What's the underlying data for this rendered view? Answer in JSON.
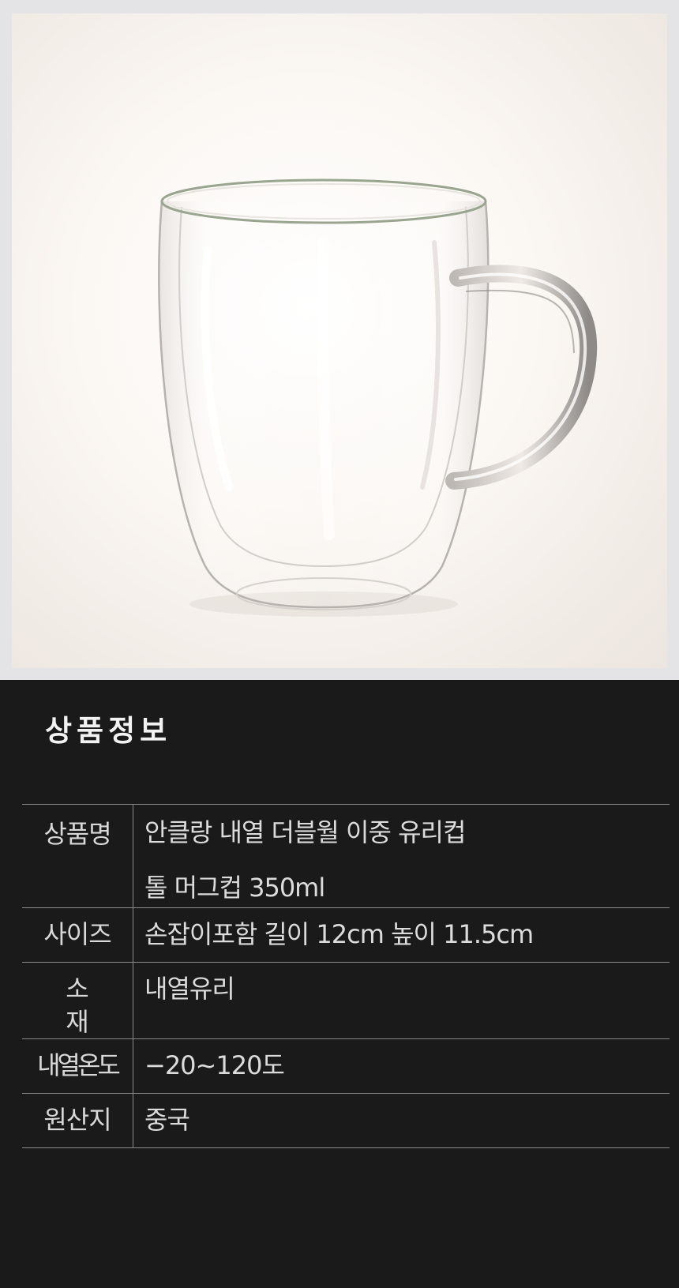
{
  "product_image": {
    "alt": "안클랑 내열 더블월 이중 유리컵 톨 머그컵 350ml",
    "colors": {
      "frame_background": "#e4e4e6",
      "photo_background": "#f7f3ef",
      "glass_edge": "#9a9a9a"
    }
  },
  "product_info": {
    "title": "상품정보",
    "rows": [
      {
        "label": "상품명",
        "value_line1": "안클랑 내열 더블월 이중 유리컵",
        "value_line2": "톨 머그컵 350ml"
      },
      {
        "label": "사이즈",
        "value": "손잡이포함 길이 12cm 높이 11.5cm"
      },
      {
        "label": "소 재",
        "value": "내열유리"
      },
      {
        "label": "내열온도",
        "value": "−20~120도"
      },
      {
        "label": "원산지",
        "value": "중국"
      }
    ]
  },
  "colors": {
    "page_background": "#1a1a1a",
    "title_text": "#f2f2f2",
    "table_text": "#dcdcdc",
    "table_border": "#8a8a8a"
  }
}
